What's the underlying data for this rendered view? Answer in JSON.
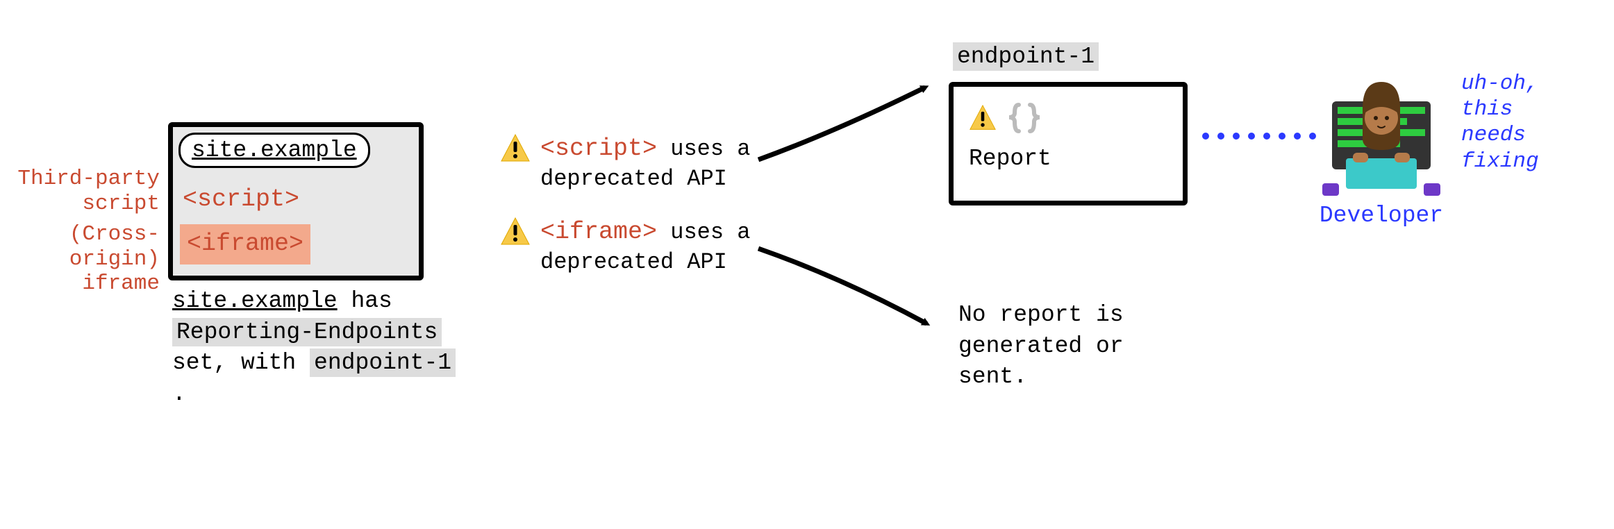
{
  "browser": {
    "urlLabel": "site.example",
    "scriptTag": "<script>",
    "iframeTag": "<iframe>"
  },
  "labels": {
    "thirdParty": "Third-party\nscript",
    "crossOrigin": "(Cross-origin)\niframe"
  },
  "caption": {
    "line1a": "site.example",
    "line1b": " has ",
    "line2a": "Reporting-Endpoints",
    "line2b": "set, with ",
    "line2c": "endpoint-1",
    "line2d": " ."
  },
  "annotations": {
    "script": {
      "tag": "<script>",
      "rest": " uses a deprecated API"
    },
    "iframe": {
      "tag": "<iframe>",
      "rest": " uses a deprecated API"
    }
  },
  "endpoint": {
    "name": "endpoint-1",
    "reportLabel": "Report"
  },
  "noReport": "No report is generated or sent.",
  "developer": {
    "thought": "uh-oh, this needs fixing",
    "label": "Developer"
  }
}
